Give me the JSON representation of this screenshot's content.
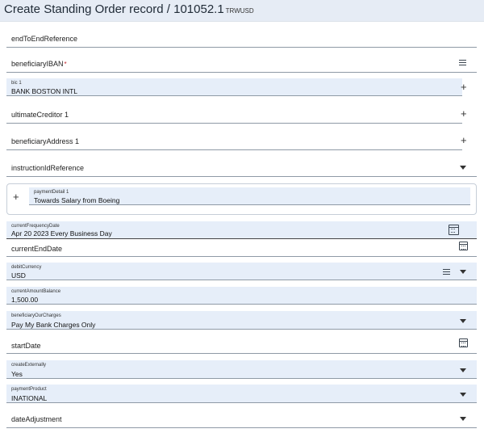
{
  "header": {
    "title": "Create Standing Order record / 101052.1",
    "subtitle": "TRWUSD"
  },
  "fields": {
    "endToEnd": {
      "label": "endToEndReference"
    },
    "beneficiaryIBAN": {
      "label": "beneficiaryIBAN",
      "required_mark": "*"
    },
    "bic": {
      "label": "bic 1",
      "value": "BANK BOSTON INTL"
    },
    "ultimateCreditor": {
      "label": "ultimateCreditor 1"
    },
    "beneficiaryAddress": {
      "label": "beneficiaryAddress 1"
    },
    "instructionId": {
      "label": "instructionIdReference"
    },
    "paymentDetail": {
      "label": "paymentDetail 1",
      "value": "Towards Salary from Boeing"
    },
    "currentFrequencyDate": {
      "label": "currentFrequencyDate",
      "value": "Apr 20 2023 Every Business Day"
    },
    "currentEndDate": {
      "label": "currentEndDate"
    },
    "debitCurrency": {
      "label": "debitCurrency",
      "value": "USD"
    },
    "currentAmountBalance": {
      "label": "currentAmountBalance",
      "value": "1,500.00"
    },
    "beneficiaryOurCharges": {
      "label": "beneficiaryOurCharges",
      "value": "Pay My Bank Charges Only"
    },
    "startDate": {
      "label": "startDate"
    },
    "createExternally": {
      "label": "createExternally",
      "value": "Yes"
    },
    "paymentProduct": {
      "label": "paymentProduct",
      "value": "INATIONAL"
    },
    "dateAdjustment": {
      "label": "dateAdjustment"
    }
  },
  "icons": {
    "add": "+",
    "list": "list-icon",
    "calendar": "calendar-icon",
    "dropdown": "caret-down-icon"
  }
}
